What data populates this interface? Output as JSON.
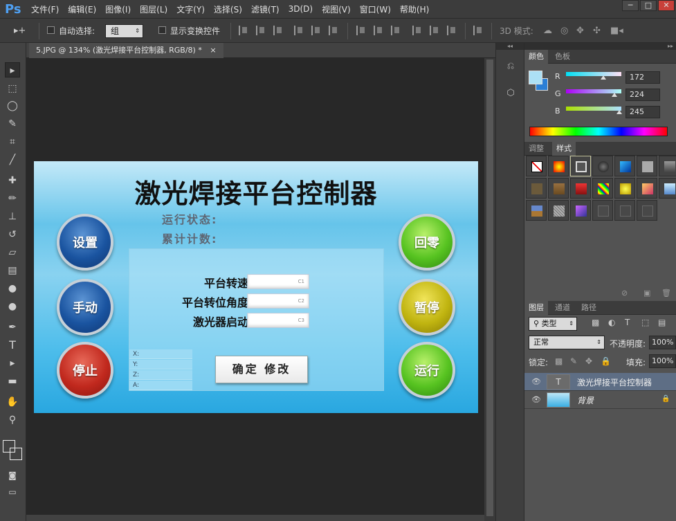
{
  "app": {
    "logo": "Ps",
    "menus": [
      "文件(F)",
      "编辑(E)",
      "图像(I)",
      "图层(L)",
      "文字(Y)",
      "选择(S)",
      "滤镜(T)",
      "3D(D)",
      "视图(V)",
      "窗口(W)",
      "帮助(H)"
    ],
    "window_controls": [
      "─",
      "□",
      "✕"
    ]
  },
  "options_bar": {
    "auto_select_label": "自动选择:",
    "auto_select_value": "组",
    "show_transform_label": "显示变换控件",
    "mode_3d_label": "3D 模式:"
  },
  "document": {
    "tab_label": "5.JPG @ 134% (激光焊接平台控制器, RGB/8) *",
    "close": "×"
  },
  "hmi": {
    "title": "激光焊接平台控制器",
    "status_running_label": "运行状态:",
    "status_total_label": "累计计数:",
    "left_buttons": [
      "设置",
      "手动",
      "停止"
    ],
    "right_buttons": [
      "回零",
      "暂停",
      "运行"
    ],
    "params": [
      {
        "label": "平台转速",
        "field": "C1"
      },
      {
        "label": "平台转位角度",
        "field": "C2"
      },
      {
        "label": "激光器启动",
        "field": "C3"
      }
    ],
    "axes": [
      "X:",
      "Y:",
      "Z:",
      "A:"
    ],
    "confirm_label": "确定 修改"
  },
  "color_panel": {
    "tabs": [
      "颜色",
      "色板"
    ],
    "channels": [
      {
        "name": "R",
        "value": "172"
      },
      {
        "name": "G",
        "value": "224"
      },
      {
        "name": "B",
        "value": "245"
      }
    ],
    "foreground": "#ace0f5",
    "background": "#2a7fd6"
  },
  "styles_panel": {
    "tabs": [
      "调整",
      "样式"
    ]
  },
  "layers_panel": {
    "tabs": [
      "图层",
      "通道",
      "路径"
    ],
    "filter_label": "类型",
    "blend_mode": "正常",
    "opacity_label": "不透明度:",
    "opacity_value": "100%",
    "lock_label": "锁定:",
    "fill_label": "填充:",
    "fill_value": "100%",
    "layers": [
      {
        "name": "激光焊接平台控制器",
        "thumb": "T"
      },
      {
        "name": "背景"
      }
    ]
  }
}
